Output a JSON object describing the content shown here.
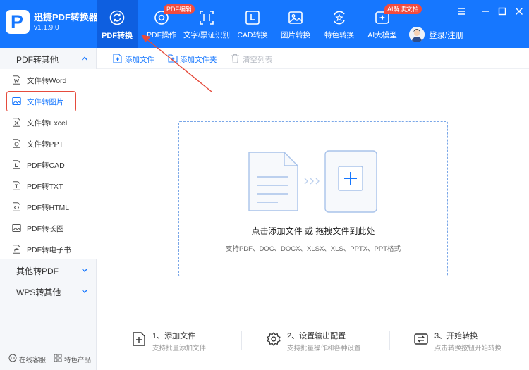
{
  "app": {
    "name": "迅捷PDF转换器",
    "version": "v1.1.9.0",
    "logo_letter": "P"
  },
  "nav": {
    "tabs": [
      {
        "label": "PDF转换",
        "icon": "refresh-icon",
        "active": true
      },
      {
        "label": "PDF操作",
        "icon": "gear-disc-icon",
        "badge": "PDF编辑"
      },
      {
        "label": "文字/票证识别",
        "icon": "scan-frame-icon"
      },
      {
        "label": "CAD转换",
        "icon": "cad-icon"
      },
      {
        "label": "图片转换",
        "icon": "image-icon"
      },
      {
        "label": "特色转换",
        "icon": "star-refresh-icon"
      },
      {
        "label": "AI大模型",
        "icon": "ai-star-icon",
        "badge": "AI解读文档"
      }
    ],
    "login_label": "登录/注册"
  },
  "window_controls": [
    "minimize",
    "maximize",
    "close"
  ],
  "sidebar": {
    "groups": [
      {
        "label": "PDF转其他",
        "expanded": true
      },
      {
        "label": "其他转PDF",
        "expanded": false
      },
      {
        "label": "WPS转其他",
        "expanded": false
      }
    ],
    "items": [
      {
        "label": "文件转Word",
        "icon": "word-file-icon"
      },
      {
        "label": "文件转图片",
        "icon": "picture-icon",
        "active": true
      },
      {
        "label": "文件转Excel",
        "icon": "excel-file-icon"
      },
      {
        "label": "文件转PPT",
        "icon": "ppt-file-icon"
      },
      {
        "label": "PDF转CAD",
        "icon": "cad-file-icon"
      },
      {
        "label": "PDF转TXT",
        "icon": "txt-file-icon"
      },
      {
        "label": "PDF转HTML",
        "icon": "html-file-icon"
      },
      {
        "label": "PDF转长图",
        "icon": "long-image-icon"
      },
      {
        "label": "PDF转电子书",
        "icon": "ebook-icon"
      }
    ],
    "footer": {
      "support_label": "在线客服",
      "featured_label": "特色产品"
    }
  },
  "toolbar": {
    "add_file": "添加文件",
    "add_folder": "添加文件夹",
    "clear_list": "清空列表"
  },
  "dropzone": {
    "title": "点击添加文件 或 拖拽文件到此处",
    "formats": "支持PDF、DOC、DOCX、XLSX、XLS、PPTX、PPT格式"
  },
  "steps": [
    {
      "title": "1、添加文件",
      "desc": "支持批量添加文件",
      "icon": "add-file-icon"
    },
    {
      "title": "2、设置输出配置",
      "desc": "支持批量操作和各种设置",
      "icon": "settings-gear-icon"
    },
    {
      "title": "3、开始转换",
      "desc": "点击转换按钮开始转换",
      "icon": "convert-icon"
    }
  ],
  "colors": {
    "brand": "#1677ff",
    "annotation": "#e54b3c",
    "badge": "#f24b3e"
  }
}
